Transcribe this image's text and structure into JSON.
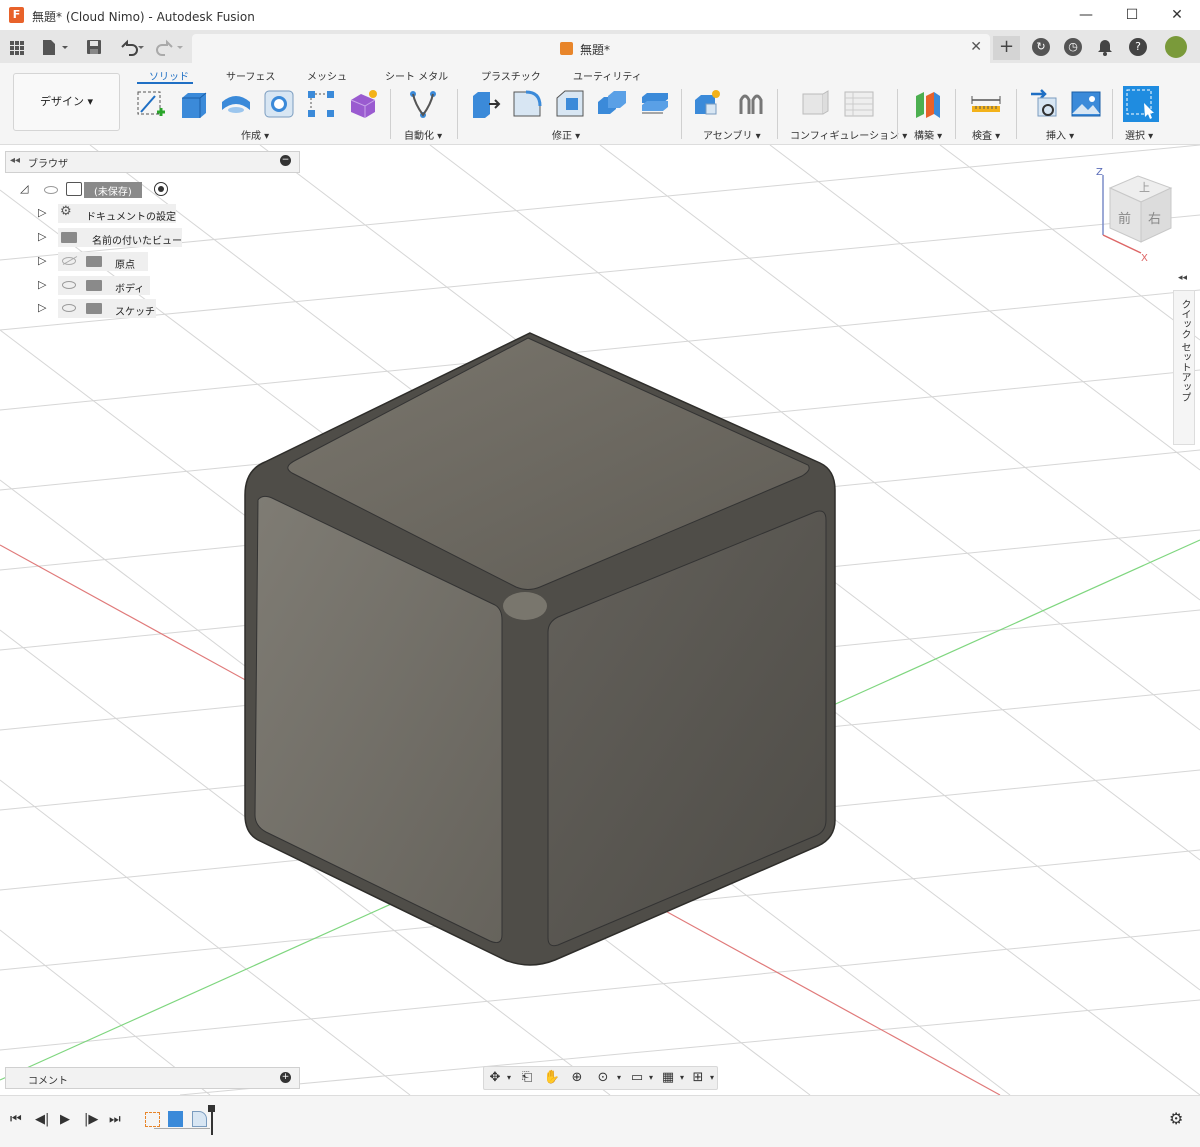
{
  "window": {
    "title": "無題* (Cloud Nimo) - Autodesk Fusion",
    "minimize": "—",
    "maximize": "☐",
    "close": "✕"
  },
  "document_tab": {
    "label": "無題*",
    "close": "✕"
  },
  "quickbar": {
    "new_tab": "+"
  },
  "ribbon": {
    "workspace": "デザイン ▾",
    "tabs": [
      "ソリッド",
      "サーフェス",
      "メッシュ",
      "シート メタル",
      "プラスチック",
      "ユーティリティ"
    ],
    "groups": [
      "作成 ▾",
      "自動化 ▾",
      "修正 ▾",
      "アセンブリ ▾",
      "コンフィギュレーション ▾",
      "構築 ▾",
      "検査 ▾",
      "挿入 ▾",
      "選択 ▾"
    ]
  },
  "browser": {
    "title": "ブラウザ",
    "root": "(未保存)",
    "items": [
      "ドキュメントの設定",
      "名前の付いたビュー",
      "原点",
      "ボディ",
      "スケッチ"
    ]
  },
  "comments": {
    "title": "コメント"
  },
  "quick_setup": {
    "label": "クイック セットアップ"
  },
  "viewcube": {
    "top": "上",
    "front": "前",
    "right": "右",
    "z_axis": "Z",
    "x_axis": "X"
  },
  "colors": {
    "accent": "#1f6fc4",
    "cube_top": "#6e6a62",
    "cube_left": "#77746c",
    "cube_right": "#5c5a53"
  }
}
